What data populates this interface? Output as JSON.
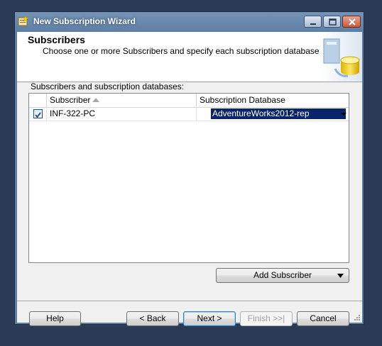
{
  "window": {
    "title": "New Subscription Wizard"
  },
  "header": {
    "title": "Subscribers",
    "subtitle": "Choose one or more Subscribers and specify each subscription database."
  },
  "grid": {
    "label": "Subscribers and subscription databases:",
    "columns": [
      "Subscriber",
      "Subscription Database"
    ],
    "sort_column": "Subscriber",
    "sort_direction": "ascending",
    "rows": [
      {
        "checked": true,
        "subscriber": "INF-322-PC",
        "database": "AdventureWorks2012-rep"
      }
    ]
  },
  "buttons": {
    "add_subscriber": "Add Subscriber",
    "help": "Help",
    "back": "< Back",
    "next": "Next >",
    "finish": "Finish >>|",
    "cancel": "Cancel"
  },
  "colors": {
    "desktop": "#2b3b55",
    "titlebar": "#5d7fa3",
    "selection": "#0a246a"
  }
}
